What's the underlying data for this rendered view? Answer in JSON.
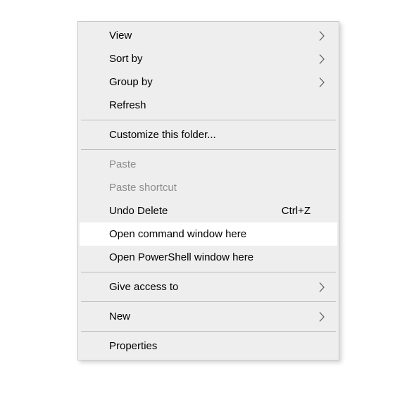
{
  "menu": {
    "view": "View",
    "sort_by": "Sort by",
    "group_by": "Group by",
    "refresh": "Refresh",
    "customize_folder": "Customize this folder...",
    "paste": "Paste",
    "paste_shortcut": "Paste shortcut",
    "undo_delete": "Undo Delete",
    "undo_delete_shortcut": "Ctrl+Z",
    "open_cmd": "Open command window here",
    "open_powershell": "Open PowerShell window here",
    "give_access": "Give access to",
    "new": "New",
    "properties": "Properties"
  }
}
